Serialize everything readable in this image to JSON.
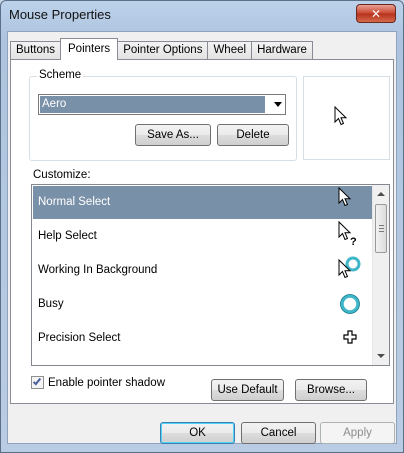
{
  "window": {
    "title": "Mouse Properties",
    "close_glyph": "✕"
  },
  "tabs": [
    {
      "label": "Buttons",
      "active": false
    },
    {
      "label": "Pointers",
      "active": true
    },
    {
      "label": "Pointer Options",
      "active": false
    },
    {
      "label": "Wheel",
      "active": false
    },
    {
      "label": "Hardware",
      "active": false
    }
  ],
  "scheme": {
    "group_label": "Scheme",
    "selected": "Aero",
    "save_as_label": "Save As...",
    "delete_label": "Delete"
  },
  "preview": {
    "icon": "arrow-cursor-icon"
  },
  "customize": {
    "label": "Customize:",
    "items": [
      {
        "label": "Normal Select",
        "icon": "arrow-cursor-icon",
        "selected": true
      },
      {
        "label": "Help Select",
        "icon": "help-cursor-icon",
        "selected": false
      },
      {
        "label": "Working In Background",
        "icon": "working-cursor-icon",
        "selected": false
      },
      {
        "label": "Busy",
        "icon": "busy-cursor-icon",
        "selected": false
      },
      {
        "label": "Precision Select",
        "icon": "precision-cursor-icon",
        "selected": false
      }
    ]
  },
  "options": {
    "shadow_label": "Enable pointer shadow",
    "shadow_checked": true,
    "use_default_label": "Use Default",
    "browse_label": "Browse..."
  },
  "dialog_buttons": {
    "ok_label": "OK",
    "cancel_label": "Cancel",
    "apply_label": "Apply",
    "apply_enabled": false
  },
  "colors": {
    "selection": "#7990a9",
    "busy_ring": "#3fb7c9"
  }
}
